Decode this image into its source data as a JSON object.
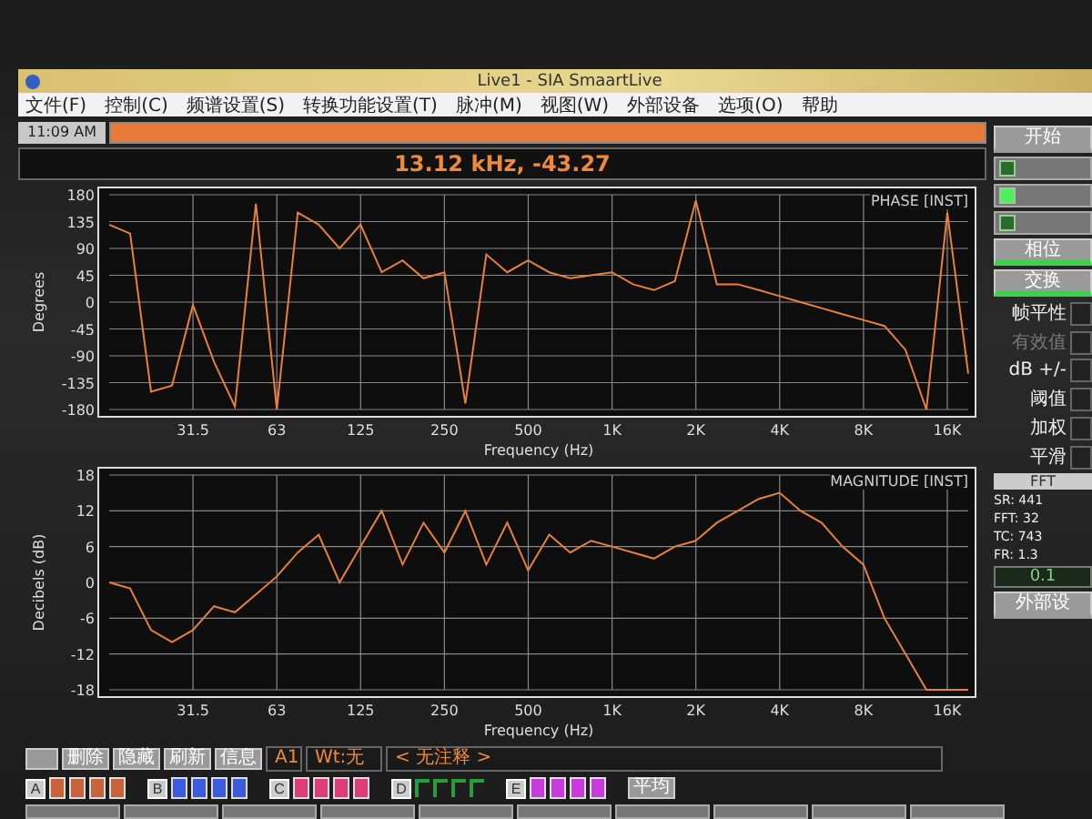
{
  "window": {
    "title": "Live1 - SIA SmaartLive"
  },
  "menu": [
    "文件(F)",
    "控制(C)",
    "频谱设置(S)",
    "转换功能设置(T)",
    "脉冲(M)",
    "视图(W)",
    "外部设备",
    "选项(O)",
    "帮助"
  ],
  "clock": "11:09 AM",
  "readout": "13.12 kHz, -43.27",
  "phase_chart": {
    "label": "PHASE [INST]",
    "chart_data": {
      "type": "line",
      "xlabel": "Frequency (Hz)",
      "ylabel": "Degrees",
      "categories": [
        null,
        null,
        null,
        null,
        "31.5",
        null,
        null,
        null,
        "63",
        null,
        null,
        null,
        "125",
        null,
        null,
        null,
        "250",
        null,
        null,
        null,
        "500",
        null,
        null,
        null,
        "1K",
        null,
        null,
        null,
        "2K",
        null,
        null,
        null,
        "4K",
        null,
        null,
        null,
        "8K",
        null,
        null,
        null,
        "16K",
        null
      ],
      "grid": true,
      "series": [
        {
          "color": "#e8803a",
          "values": [
            130,
            115,
            -150,
            -140,
            -5,
            -100,
            -175,
            165,
            -180,
            150,
            130,
            90,
            130,
            50,
            70,
            40,
            50,
            -170,
            80,
            50,
            70,
            50,
            40,
            45,
            50,
            30,
            20,
            35,
            170,
            30,
            30,
            20,
            10,
            0,
            -10,
            -20,
            -30,
            -40,
            -80,
            -180,
            150,
            -120
          ]
        }
      ],
      "ylim": [
        -180,
        180
      ],
      "yticks": [
        -180,
        -135,
        -90,
        -45,
        0,
        45,
        90,
        135,
        180
      ]
    }
  },
  "magnitude_chart": {
    "label": "MAGNITUDE [INST]",
    "chart_data": {
      "type": "line",
      "xlabel": "Frequency (Hz)",
      "ylabel": "Decibels (dB)",
      "categories": [
        null,
        null,
        null,
        null,
        "31.5",
        null,
        null,
        null,
        "63",
        null,
        null,
        null,
        "125",
        null,
        null,
        null,
        "250",
        null,
        null,
        null,
        "500",
        null,
        null,
        null,
        "1K",
        null,
        null,
        null,
        "2K",
        null,
        null,
        null,
        "4K",
        null,
        null,
        null,
        "8K",
        null,
        null,
        null,
        "16K",
        null
      ],
      "grid": true,
      "series": [
        {
          "color": "#e8803a",
          "values": [
            0,
            -1,
            -8,
            -10,
            -8,
            -4,
            -5,
            -2,
            1,
            5,
            8,
            0,
            6,
            12,
            3,
            10,
            5,
            12,
            3,
            10,
            2,
            8,
            5,
            7,
            6,
            5,
            4,
            6,
            7,
            10,
            12,
            14,
            15,
            12,
            10,
            6,
            3,
            -6,
            -12,
            -18,
            -18,
            -18
          ]
        }
      ],
      "ylim": [
        -18,
        18
      ],
      "yticks": [
        -18,
        -12,
        -6,
        0,
        6,
        12,
        18
      ]
    }
  },
  "side_panel": [
    {
      "kind": "button",
      "label": "开始"
    },
    {
      "kind": "toggle",
      "on": false
    },
    {
      "kind": "toggle",
      "on": true
    },
    {
      "kind": "toggle",
      "on": false
    },
    {
      "kind": "mode",
      "label": "相位",
      "on": true
    },
    {
      "kind": "mode",
      "label": "交换",
      "on": true
    },
    {
      "kind": "option",
      "label": "帧平性",
      "disabled": false
    },
    {
      "kind": "option",
      "label": "有效值",
      "disabled": true
    },
    {
      "kind": "option",
      "label": "dB +/-",
      "disabled": false
    },
    {
      "kind": "option",
      "label": "阈值",
      "disabled": false
    },
    {
      "kind": "option",
      "label": "加权",
      "disabled": false
    },
    {
      "kind": "option",
      "label": "平滑",
      "disabled": false
    },
    {
      "kind": "header",
      "label": "FFT"
    },
    {
      "kind": "info",
      "label": "SR: 441"
    },
    {
      "kind": "info",
      "label": "FFT: 32"
    },
    {
      "kind": "info",
      "label": "TC: 743"
    },
    {
      "kind": "info",
      "label": "FR: 1.3"
    },
    {
      "kind": "value",
      "label": "0.1"
    },
    {
      "kind": "button",
      "label": "外部设"
    }
  ],
  "trace_buttons": [
    "删除",
    "隐藏",
    "刷新",
    "信息"
  ],
  "trace_fields": [
    "A1",
    "Wt:无",
    "< 无注释 >"
  ],
  "trace_groups": [
    {
      "letter": "A",
      "color": "#c8643c",
      "kind": "block"
    },
    {
      "letter": "B",
      "color": "#3c5adc",
      "kind": "block"
    },
    {
      "letter": "C",
      "color": "#dc3c78",
      "kind": "block"
    },
    {
      "letter": "D",
      "color": "#2a9a3a",
      "kind": "corner"
    },
    {
      "letter": "E",
      "color": "#c83cdc",
      "kind": "block"
    }
  ],
  "average_button": "平均"
}
